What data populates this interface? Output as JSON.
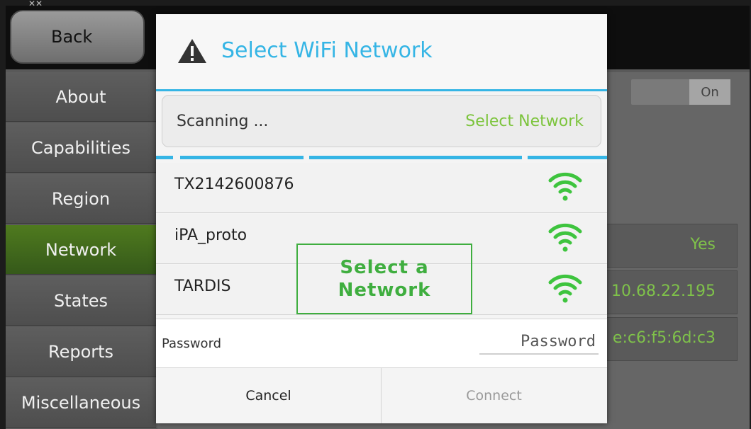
{
  "topbar": {
    "back_label": "Back"
  },
  "sidebar": {
    "items": [
      {
        "label": "About"
      },
      {
        "label": "Capabilities"
      },
      {
        "label": "Region"
      },
      {
        "label": "Network"
      },
      {
        "label": "States"
      },
      {
        "label": "Reports"
      },
      {
        "label": "Miscellaneous"
      }
    ],
    "active_index": 3
  },
  "background": {
    "toggle_label": "On",
    "values": [
      "Yes",
      "10.68.22.195",
      "e:c6:f5:6d:c3"
    ]
  },
  "dialog": {
    "title": "Select WiFi Network",
    "scan_status": "Scanning ...",
    "select_network_label": "Select Network",
    "networks": [
      {
        "name": "TX2142600876",
        "signal_icon": "wifi-full-icon"
      },
      {
        "name": "iPA_proto",
        "signal_icon": "wifi-full-icon"
      },
      {
        "name": "TARDIS",
        "signal_icon": "wifi-full-icon"
      }
    ],
    "password_label": "Password",
    "password_placeholder": "Password",
    "cancel_label": "Cancel",
    "connect_label": "Connect"
  },
  "annotation": {
    "text_line1": "Select a",
    "text_line2": "Network"
  },
  "colors": {
    "accent_blue": "#35b5e5",
    "accent_green": "#7cc43c",
    "active_nav": "#4f7a1e"
  }
}
